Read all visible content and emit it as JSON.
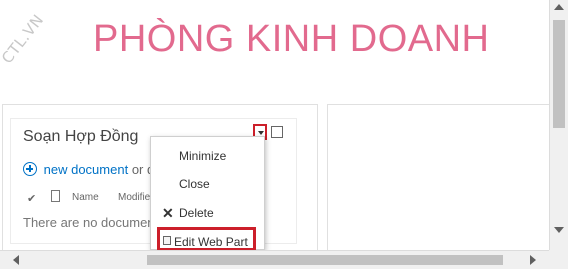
{
  "watermark": "CTL.VN",
  "page": {
    "title": "PHÒNG KINH DOANH"
  },
  "webpart": {
    "title": "Soạn Hợp Đồng",
    "new_document": "new document",
    "or_text": "or d",
    "columns": {
      "check": "✔",
      "name": "Name",
      "modified": "Modifie"
    },
    "empty_message": "There are no documen"
  },
  "menu": {
    "items": [
      "Minimize",
      "Close",
      "Delete",
      "Edit Web Part"
    ]
  },
  "icons": {
    "dropdown": "chevron-down-icon",
    "delete": "x-icon",
    "edit": "edit-page-icon",
    "new": "plus-circle-icon",
    "document": "document-icon"
  },
  "colors": {
    "title": "#e26a8e",
    "link": "#0072c6",
    "highlight": "#cc1f2a"
  }
}
